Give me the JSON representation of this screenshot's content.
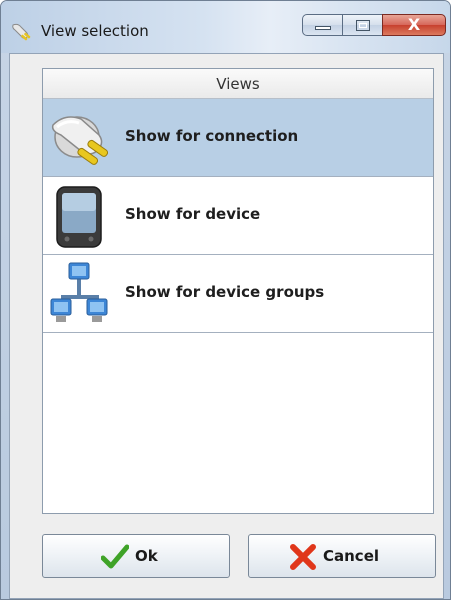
{
  "window": {
    "title": "View selection",
    "controls": {
      "minimize": "minimize",
      "maximize": "maximize",
      "close_glyph": "X"
    }
  },
  "views_list": {
    "header": "Views",
    "items": [
      {
        "label": "Show for connection",
        "icon": "plug-connection-icon",
        "selected": true
      },
      {
        "label": "Show for device",
        "icon": "handheld-device-icon",
        "selected": false
      },
      {
        "label": "Show for device groups",
        "icon": "network-computers-icon",
        "selected": false
      }
    ]
  },
  "buttons": {
    "ok_label": "Ok",
    "ok_icon": "checkmark-icon",
    "cancel_label": "Cancel",
    "cancel_icon": "red-x-icon"
  },
  "colors": {
    "selection": "#b8cfe5",
    "checkmark": "#3fa328",
    "cancel_x": "#e0361a"
  }
}
